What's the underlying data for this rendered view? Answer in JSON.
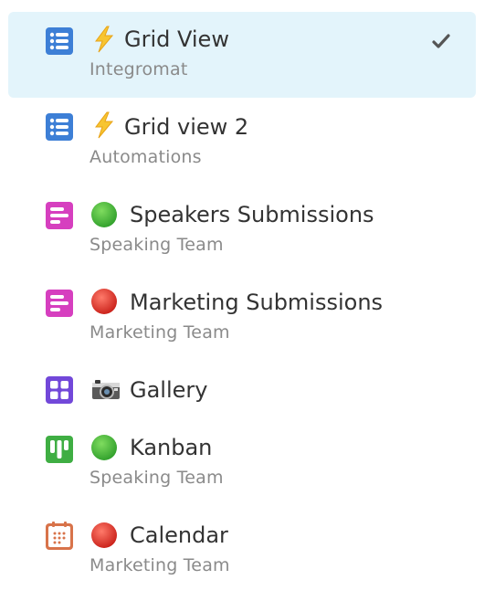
{
  "views": [
    {
      "name": "Grid View",
      "subtitle": "Integromat",
      "view_icon": "grid-view-icon",
      "emoji_icon": "lightning-icon",
      "selected": true,
      "color": "#3d7fd6"
    },
    {
      "name": "Grid view 2",
      "subtitle": "Automations",
      "view_icon": "grid-view-icon",
      "emoji_icon": "lightning-icon",
      "selected": false,
      "color": "#3d7fd6"
    },
    {
      "name": "Speakers Submissions",
      "subtitle": "Speaking Team",
      "view_icon": "form-view-icon",
      "emoji_icon": "green-circle-icon",
      "selected": false,
      "color": "#d63fbf"
    },
    {
      "name": "Marketing Submissions",
      "subtitle": "Marketing Team",
      "view_icon": "form-view-icon",
      "emoji_icon": "red-circle-icon",
      "selected": false,
      "color": "#d63fbf"
    },
    {
      "name": "Gallery",
      "subtitle": "",
      "view_icon": "gallery-view-icon",
      "emoji_icon": "camera-icon",
      "selected": false,
      "color": "#7248d9"
    },
    {
      "name": "Kanban",
      "subtitle": "Speaking Team",
      "view_icon": "kanban-view-icon",
      "emoji_icon": "green-circle-icon",
      "selected": false,
      "color": "#3fae43"
    },
    {
      "name": "Calendar",
      "subtitle": "Marketing Team",
      "view_icon": "calendar-view-icon",
      "emoji_icon": "red-circle-icon",
      "selected": false,
      "color": "#d8734a"
    }
  ],
  "selected_check_icon": "checkmark-icon"
}
